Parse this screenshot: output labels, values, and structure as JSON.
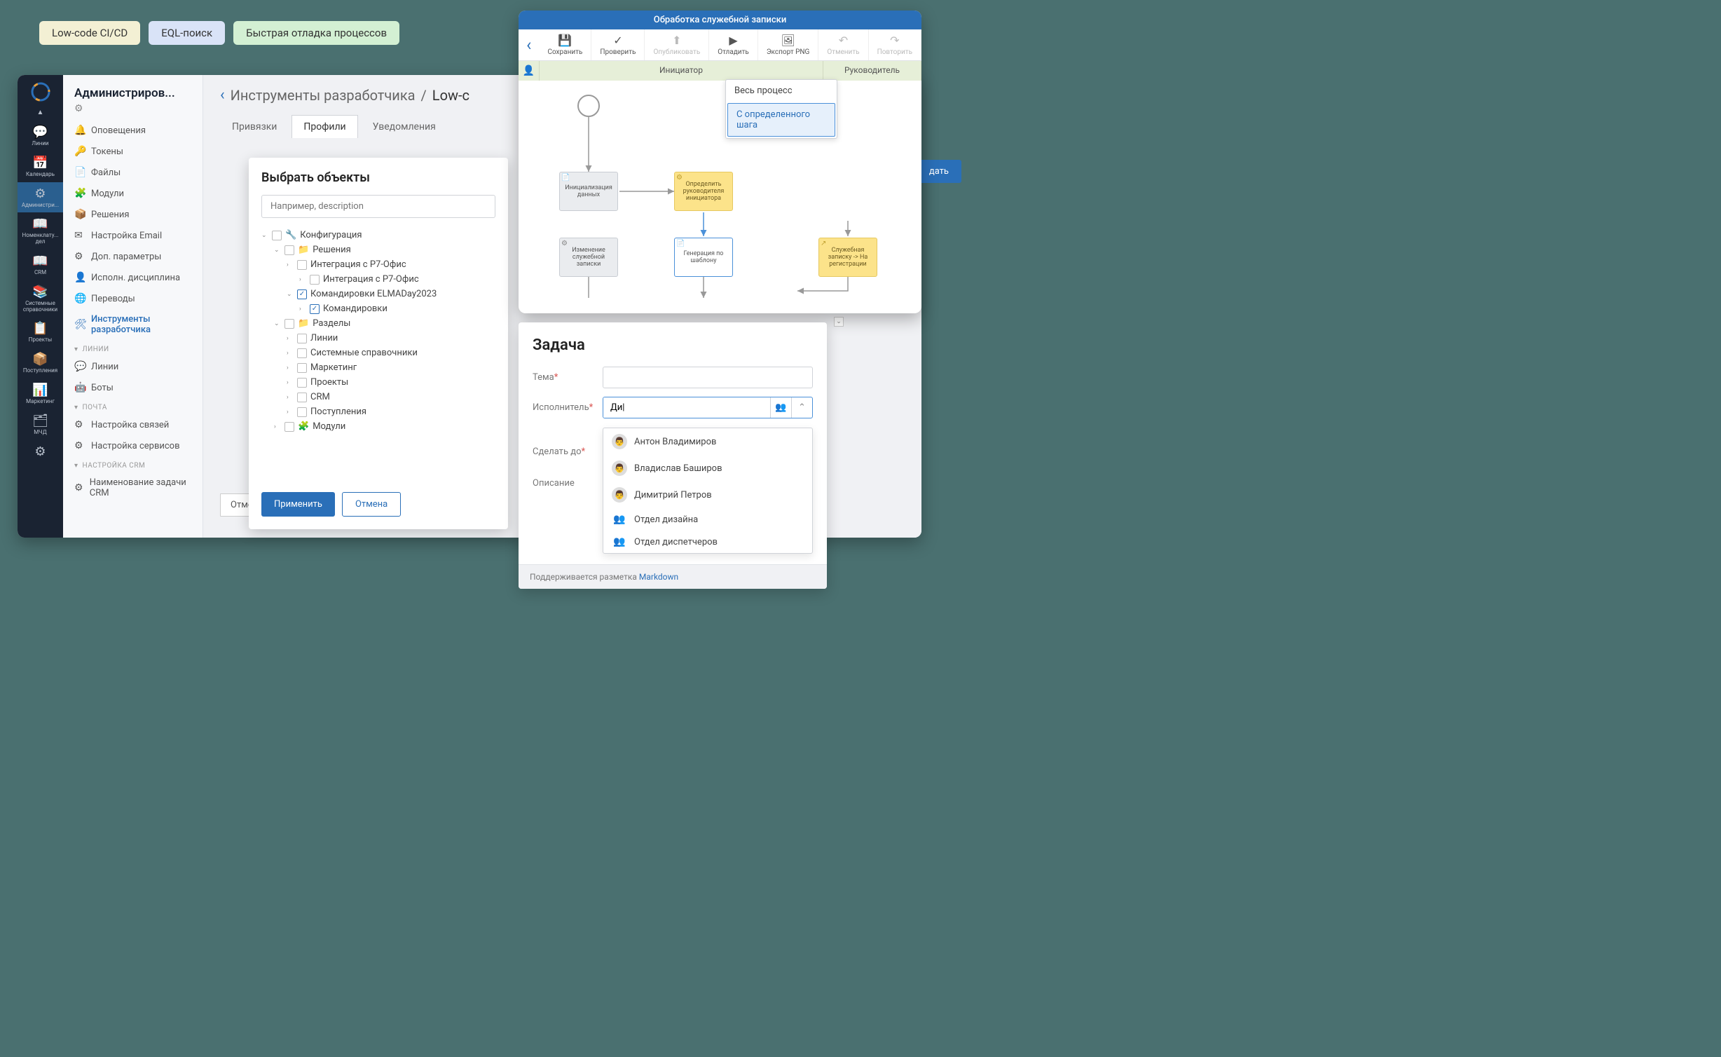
{
  "chips": {
    "cicd": "Low-code CI/CD",
    "eql": "EQL-поиск",
    "debug": "Быстрая отладка процессов"
  },
  "rail": {
    "items": [
      {
        "icon": "💬",
        "label": "Линии"
      },
      {
        "icon": "📅",
        "label": "Календарь"
      },
      {
        "icon": "⚙",
        "label": "Администри..."
      },
      {
        "icon": "📖",
        "label": "Номенклату... дел"
      },
      {
        "icon": "📖",
        "label": "CRM"
      },
      {
        "icon": "📚",
        "label": "Системные справочники"
      },
      {
        "icon": "📋",
        "label": "Проекты"
      },
      {
        "icon": "📦",
        "label": "Поступления"
      },
      {
        "icon": "📊",
        "label": "Маркетинг"
      },
      {
        "icon": "🗂",
        "label": "МЧД"
      },
      {
        "icon": "⚙",
        "label": ""
      }
    ]
  },
  "sidebar": {
    "title": "Администриров...",
    "items": [
      {
        "icon": "🔔",
        "label": "Оповещения"
      },
      {
        "icon": "🔑",
        "label": "Токены"
      },
      {
        "icon": "📄",
        "label": "Файлы"
      },
      {
        "icon": "🧩",
        "label": "Модули"
      },
      {
        "icon": "📦",
        "label": "Решения"
      },
      {
        "icon": "✉",
        "label": "Настройка Email"
      },
      {
        "icon": "⚙",
        "label": "Доп. параметры"
      },
      {
        "icon": "👤",
        "label": "Исполн. дисциплина"
      },
      {
        "icon": "🌐",
        "label": "Переводы"
      },
      {
        "icon": "🛠",
        "label": "Инструменты разработчика"
      }
    ],
    "groups": [
      {
        "label": "ЛИНИИ",
        "items": [
          {
            "icon": "💬",
            "label": "Линии"
          },
          {
            "icon": "🤖",
            "label": "Боты"
          }
        ]
      },
      {
        "label": "ПОЧТА",
        "items": [
          {
            "icon": "⚙",
            "label": "Настройка связей"
          },
          {
            "icon": "⚙",
            "label": "Настройка сервисов"
          }
        ]
      },
      {
        "label": "НАСТРОЙКА CRM",
        "items": [
          {
            "icon": "⚙",
            "label": "Наименование задачи CRM"
          }
        ]
      }
    ]
  },
  "breadcrumb": {
    "parent": "Инструменты разработчика",
    "current": "Low-c"
  },
  "tabs": [
    "Привязки",
    "Профили",
    "Уведомления"
  ],
  "modal": {
    "title": "Выбрать объекты",
    "search_placeholder": "Например, description",
    "tree": {
      "root": "Конфигурация",
      "solutions": "Решения",
      "int1": "Интеграция с Р7-Офис",
      "int2": "Интеграция с Р7-Офис",
      "trips": "Командировки ELMADay2023",
      "trips_child": "Командировки",
      "sections": "Разделы",
      "section_items": [
        "Линии",
        "Системные справочники",
        "Маркетинг",
        "Проекты",
        "CRM",
        "Поступления"
      ],
      "modules": "Модули"
    },
    "apply": "Применить",
    "cancel": "Отмена"
  },
  "process": {
    "title": "Обработка служебной записки",
    "toolbar": {
      "save": "Сохранить",
      "check": "Проверить",
      "publish": "Опубликовать",
      "debug": "Отладить",
      "export": "Экспорт PNG",
      "undo": "Отменить",
      "redo": "Повторить"
    },
    "lanes": {
      "initiator": "Инициатор",
      "manager": "Руководитель"
    },
    "nodes": {
      "init": "Инициализация данных",
      "change": "Изменение служебной записки",
      "determine": "Определить руководителя инициатора",
      "generate": "Генерация по шаблону",
      "register": "Служебная записку -> На регистрации"
    },
    "dropdown": {
      "all": "Весь процесс",
      "from_step": "С определенного шага"
    }
  },
  "create_btn": "дать",
  "task": {
    "title": "Задача",
    "labels": {
      "topic": "Тема",
      "executor": "Исполнитель",
      "due": "Сделать до",
      "desc": "Описание"
    },
    "executor_value": "Ди|",
    "suggestions": [
      {
        "type": "user",
        "name": "Антон Владимиров"
      },
      {
        "type": "user",
        "name": "Владислав Баширов"
      },
      {
        "type": "user",
        "name": "Димитрий Петров"
      },
      {
        "type": "group",
        "name": "Отдел дизайна"
      },
      {
        "type": "group",
        "name": "Отдел диспетчеров"
      }
    ],
    "markdown_hint": "Поддерживается разметка ",
    "markdown_link": "Markdown"
  },
  "bottom_cancel": "Отмен"
}
